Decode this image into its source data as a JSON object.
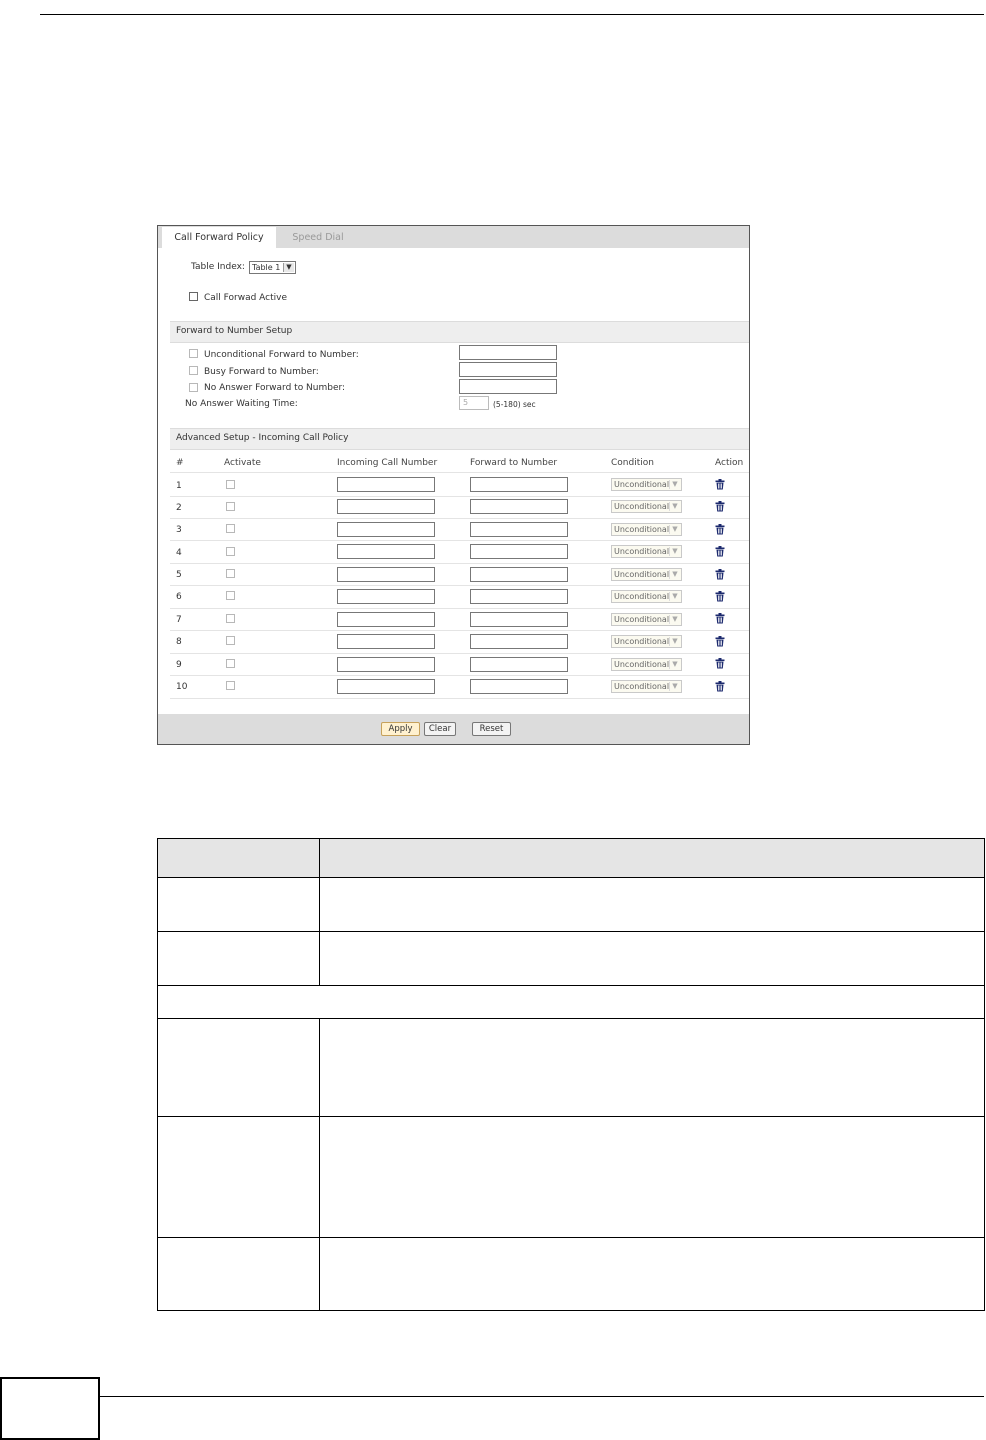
{
  "tabs": [
    {
      "label": "Call Forward Policy",
      "active": true
    },
    {
      "label": "Speed Dial",
      "active": false
    }
  ],
  "table_index": {
    "label": "Table Index:",
    "value": "Table 1"
  },
  "call_forward_active": {
    "label": "Call Forwad Active",
    "checked": false
  },
  "forward_setup": {
    "title": "Forward to Number Setup",
    "unconditional_label": "Unconditional Forward to Number:",
    "busy_label": "Busy Forward to Number:",
    "no_answer_label": "No Answer Forward to Number:",
    "waiting_label": "No Answer Waiting Time:",
    "waiting_value": "5",
    "waiting_hint": "(5-180) sec"
  },
  "advanced": {
    "title": "Advanced Setup - Incoming Call Policy",
    "headers": [
      "#",
      "Activate",
      "Incoming Call Number",
      "Forward to Number",
      "Condition",
      "Action"
    ],
    "rows": [
      {
        "num": "1",
        "condition": "Unconditional"
      },
      {
        "num": "2",
        "condition": "Unconditional"
      },
      {
        "num": "3",
        "condition": "Unconditional"
      },
      {
        "num": "4",
        "condition": "Unconditional"
      },
      {
        "num": "5",
        "condition": "Unconditional"
      },
      {
        "num": "6",
        "condition": "Unconditional"
      },
      {
        "num": "7",
        "condition": "Unconditional"
      },
      {
        "num": "8",
        "condition": "Unconditional"
      },
      {
        "num": "9",
        "condition": "Unconditional"
      },
      {
        "num": "10",
        "condition": "Unconditional"
      }
    ]
  },
  "buttons": {
    "apply": "Apply",
    "clear": "Clear",
    "reset": "Reset"
  },
  "icons": {
    "dropdown": "chevron-down-icon",
    "delete": "trash-icon"
  },
  "colors": {
    "tab_bar": "#dcdcdc",
    "section_bg": "#eeeeee",
    "apply_bg": "#fff1cf",
    "trash": "#1c2a6e"
  }
}
